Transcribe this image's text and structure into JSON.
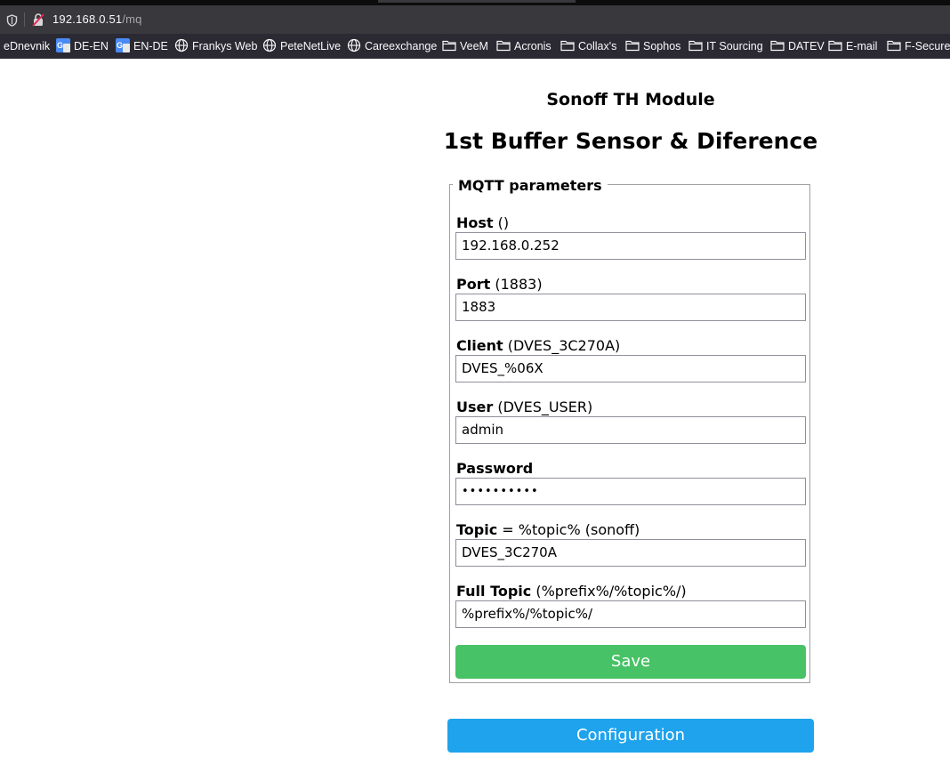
{
  "browser": {
    "url_host": "192.168.0.51",
    "url_path": "/mq",
    "bookmarks": [
      {
        "label": "eDnevnik",
        "icon": "none"
      },
      {
        "label": "DE-EN",
        "icon": "translate-icon"
      },
      {
        "label": "EN-DE",
        "icon": "translate-icon"
      },
      {
        "label": "Frankys Web",
        "icon": "globe-icon"
      },
      {
        "label": "PeteNetLive",
        "icon": "globe-icon"
      },
      {
        "label": "Careexchange",
        "icon": "globe-icon"
      },
      {
        "label": "VeeM",
        "icon": "folder-icon"
      },
      {
        "label": "Acronis",
        "icon": "folder-icon"
      },
      {
        "label": "Collax's",
        "icon": "folder-icon"
      },
      {
        "label": "Sophos",
        "icon": "folder-icon"
      },
      {
        "label": "IT Sourcing",
        "icon": "folder-icon"
      },
      {
        "label": "DATEV",
        "icon": "folder-icon"
      },
      {
        "label": "E-mail",
        "icon": "folder-icon"
      },
      {
        "label": "F-Secure",
        "icon": "folder-icon"
      }
    ]
  },
  "page": {
    "module_title": "Sonoff TH Module",
    "device_title": "1st Buffer Sensor & Diference",
    "legend": "MQTT parameters",
    "fields": {
      "host": {
        "label": "Host",
        "hint": " ()",
        "value": "192.168.0.252"
      },
      "port": {
        "label": "Port",
        "hint": " (1883)",
        "value": "1883"
      },
      "client": {
        "label": "Client",
        "hint": " (DVES_3C270A)",
        "value": "DVES_%06X"
      },
      "user": {
        "label": "User",
        "hint": " (DVES_USER)",
        "value": "admin"
      },
      "password": {
        "label": "Password",
        "hint": "",
        "value": "••••••••••"
      },
      "topic": {
        "label": "Topic",
        "hint": " = %topic% (sonoff)",
        "value": "DVES_3C270A"
      },
      "full_topic": {
        "label": "Full Topic",
        "hint": " (%prefix%/%topic%/)",
        "value": "%prefix%/%topic%/"
      }
    },
    "save_label": "Save",
    "config_label": "Configuration"
  },
  "colors": {
    "save_button": "#47c266",
    "config_button": "#1fa3ec"
  }
}
